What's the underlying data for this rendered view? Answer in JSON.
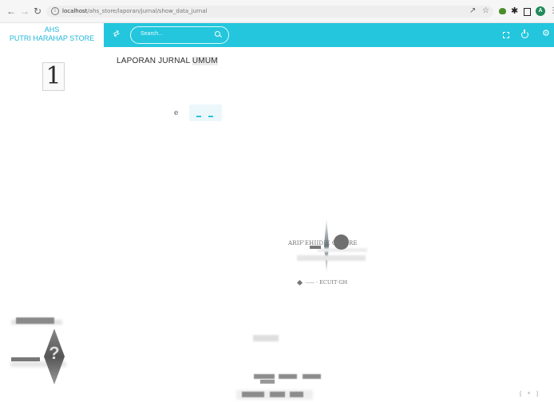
{
  "browser": {
    "url_host": "localhost",
    "url_path": "/ahs_store/laporan/jurnal/show_data_jurnal",
    "profile_initial": "A"
  },
  "brand": {
    "line1": "AHS",
    "line2": "PUTRI HARAHAP STORE"
  },
  "topbar": {
    "search_placeholder": "Search..."
  },
  "content": {
    "page_number": "1",
    "report_title_prefix": "LAPORAN JURNAL ",
    "report_title_highlight": "UMUM",
    "small_label": "e"
  },
  "stamp": {
    "line1": "ARIF'EHIIDIE    OLTORE",
    "line2": "----- · ECUIT·GH"
  },
  "footer": {
    "corner_text": "[ * ]"
  },
  "colors": {
    "accent": "#23c6dc",
    "brand_text": "#1fb6d9"
  },
  "icons": [
    "back-arrow-icon",
    "forward-arrow-icon",
    "reload-icon",
    "info-icon",
    "share-icon",
    "bookmark-star-icon",
    "extension-icon",
    "puzzle-icon",
    "sidebar-icon",
    "profile-avatar",
    "menu-dots-icon",
    "sidebar-toggle-icon",
    "search-icon",
    "fullscreen-icon",
    "power-icon",
    "gear-icon"
  ]
}
